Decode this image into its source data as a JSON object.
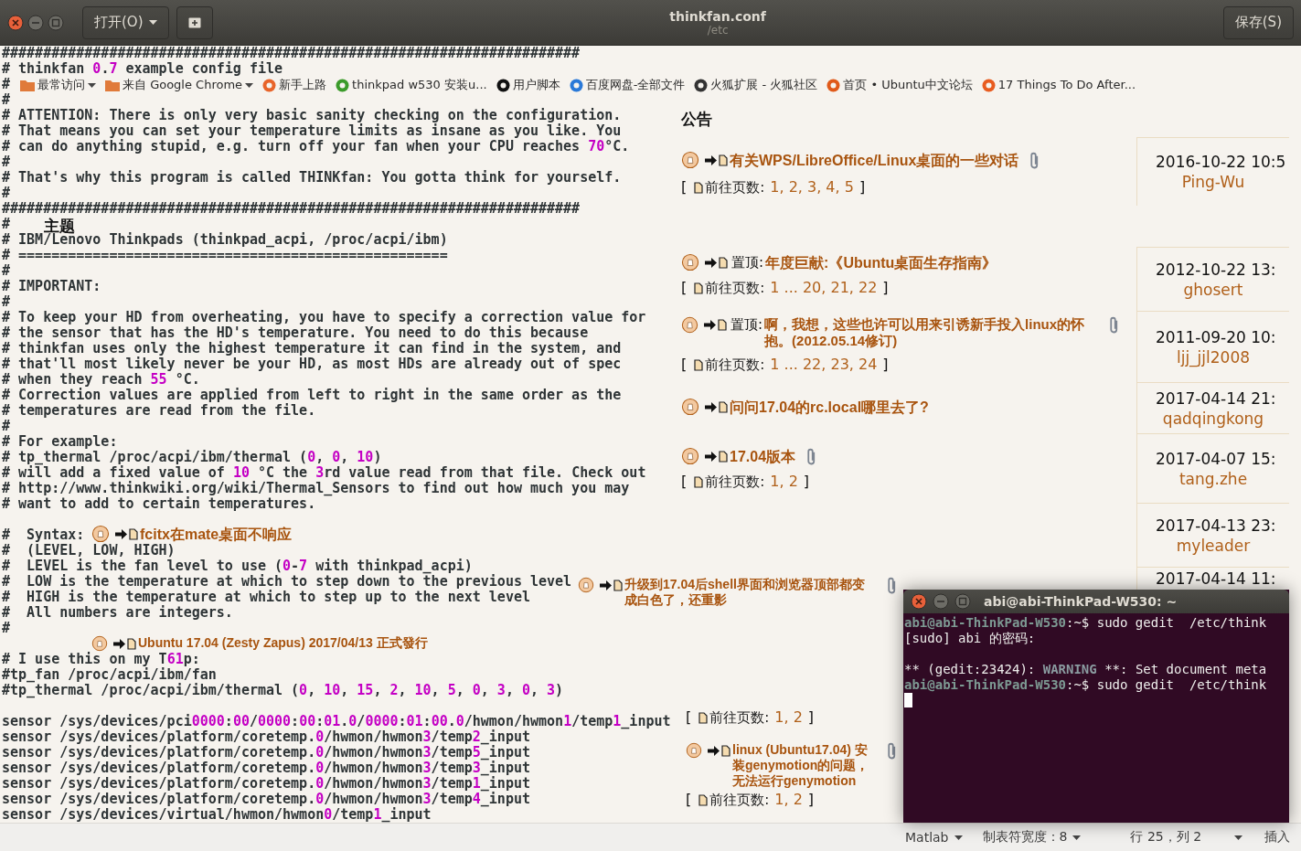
{
  "window": {
    "title": "thinkfan.conf",
    "subtitle": "/etc",
    "open_button": "打开(O)",
    "save_button": "保存(S)"
  },
  "editor": {
    "blocks": [
      [
        "######################################################################",
        "# thinkfan 0.7 example config file",
        "#",
        "#",
        "# ATTENTION: There is only very basic sanity checking on the configuration.",
        "# That means you can set your temperature limits as insane as you like. You",
        "# can do anything stupid, e.g. turn off your fan when your CPU reaches 70°C.",
        "#",
        "# That's why this program is called THINKfan: You gotta think for yourself.",
        "#",
        "######################################################################",
        "#",
        "# IBM/Lenovo Thinkpads (thinkpad_acpi, /proc/acpi/ibm)",
        "# ====================================================",
        "#",
        "# IMPORTANT:",
        "#",
        "# To keep your HD from overheating, you have to specify a correction value for",
        "# the sensor that has the HD's temperature. You need to do this because",
        "# thinkfan uses only the highest temperature it can find in the system, and",
        "# that'll most likely never be your HD, as most HDs are already out of spec",
        "# when they reach 55 °C.",
        "# Correction values are applied from left to right in the same order as the",
        "# temperatures are read from the file.",
        "#",
        "# For example:",
        "# tp_thermal /proc/acpi/ibm/thermal (0, 0, 10)",
        "# will add a fixed value of 10 °C the 3rd value read from that file. Check out",
        "# http://www.thinkwiki.org/wiki/Thermal_Sensors to find out how much you may",
        "# want to add to certain temperatures."
      ],
      [
        "#  Syntax:",
        "#  (LEVEL, LOW, HIGH)",
        "#  LEVEL is the fan level to use (0-7 with thinkpad_acpi)",
        "#  LOW is the temperature at which to step down to the previous level",
        "#  HIGH is the temperature at which to step up to the next level",
        "#  All numbers are integers.",
        "#"
      ],
      [
        "# I use this on my T61p:",
        "#tp_fan /proc/acpi/ibm/fan",
        "#tp_thermal /proc/acpi/ibm/thermal (0, 10, 15, 2, 10, 5, 0, 3, 0, 3)"
      ],
      [
        "sensor /sys/devices/pci0000:00/0000:00:01.0/0000:01:00.0/hwmon/hwmon1/temp1_input",
        "sensor /sys/devices/platform/coretemp.0/hwmon/hwmon3/temp2_input",
        "sensor /sys/devices/platform/coretemp.0/hwmon/hwmon3/temp5_input",
        "sensor /sys/devices/platform/coretemp.0/hwmon/hwmon3/temp3_input",
        "sensor /sys/devices/platform/coretemp.0/hwmon/hwmon3/temp1_input",
        "sensor /sys/devices/platform/coretemp.0/hwmon/hwmon3/temp4_input",
        "sensor /sys/devices/virtual/hwmon/hwmon0/temp1_input"
      ]
    ]
  },
  "bookmarks": [
    {
      "label": "最常访问",
      "menu": true
    },
    {
      "label": "来自 Google Chrome",
      "menu": true
    },
    {
      "label": "新手上路",
      "menu": false
    },
    {
      "label": "thinkpad w530 安装u...",
      "menu": false
    },
    {
      "label": "用户脚本",
      "menu": false
    },
    {
      "label": "百度网盘-全部文件",
      "menu": false
    },
    {
      "label": "火狐扩展 - 火狐社区",
      "menu": false
    },
    {
      "label": "首页 • Ubuntu中文论坛",
      "menu": false
    },
    {
      "label": "17 Things To Do After...",
      "menu": false
    }
  ],
  "forum": {
    "items": [
      {
        "kind": "heading",
        "text": "公告"
      },
      {
        "kind": "topic",
        "title": "有关WPS/LibreOffice/Linux桌面的一些对话",
        "attachment": true
      },
      {
        "kind": "pages",
        "open": "[",
        "label": "前往页数:",
        "numbers": "1, 2, 3, 4, 5",
        "close": "]"
      },
      {
        "kind": "heading",
        "text": "主题"
      },
      {
        "kind": "topic",
        "prefix": "置顶:",
        "title": "年度巨献:《Ubuntu桌面生存指南》",
        "attachment": false
      },
      {
        "kind": "pages",
        "open": "[",
        "label": "前往页数:",
        "numbers": "1 ... 20, 21, 22",
        "close": "]"
      },
      {
        "kind": "topic",
        "prefix": "置顶:",
        "title": "啊，我想，这些也许可以用来引诱新手投入linux的怀抱。(2012.05.14修订)",
        "attachment": true
      },
      {
        "kind": "pages",
        "open": "[",
        "label": "前往页数:",
        "numbers": "1 ... 22, 23, 24",
        "close": "]"
      },
      {
        "kind": "topic",
        "title": "问问17.04的rc.local哪里去了?",
        "attachment": false
      },
      {
        "kind": "topic",
        "title": "17.04版本",
        "attachment": true
      },
      {
        "kind": "pages",
        "open": "[",
        "label": "前往页数:",
        "numbers": "1, 2",
        "close": "]"
      },
      {
        "kind": "topic",
        "title": "fcitx在mate桌面不响应",
        "attachment": false
      },
      {
        "kind": "topic",
        "title": "升级到17.04后shell界面和浏览器顶部都变成白色了，还重影",
        "attachment": true
      },
      {
        "kind": "topic",
        "title": "Ubuntu 17.04 (Zesty Zapus) 2017/04/13 正式發行",
        "attachment": false
      },
      {
        "kind": "pages",
        "open": "[",
        "label": "前往页数:",
        "numbers": "1, 2",
        "close": "]"
      },
      {
        "kind": "topic",
        "title": "linux (Ubuntu17.04) 安装genymotion的问题，无法运行genymotion",
        "attachment": true
      },
      {
        "kind": "pages",
        "open": "[",
        "label": "前往页数:",
        "numbers": "1, 2",
        "close": "]"
      }
    ],
    "last_posts": [
      {
        "time": "2016-10-22 10:5",
        "author": "Ping-Wu"
      },
      {
        "time": "2012-10-22 13:",
        "author": "ghosert"
      },
      {
        "time": "2011-09-20 10:",
        "author": "ljj_jjl2008"
      },
      {
        "time": "2017-04-14 21:",
        "author": "qadqingkong"
      },
      {
        "time": "2017-04-07 15:",
        "author": "tang.zhe"
      },
      {
        "time": "2017-04-13 23:",
        "author": "myleader"
      },
      {
        "time": "2017-04-14 11:"
      }
    ]
  },
  "terminal": {
    "title": "abi@abi-ThinkPad-W530: ~",
    "lines": [
      {
        "kind": "command",
        "prompt": "abi@abi-ThinkPad-W530",
        "text": ":~$ sudo gedit  /etc/think"
      },
      {
        "kind": "output",
        "text": "[sudo] abi 的密码:"
      },
      {
        "kind": "blank"
      },
      {
        "kind": "warning",
        "before": "** (gedit:23424): ",
        "warning": "WARNING",
        "text": " **: Set document meta"
      },
      {
        "kind": "command",
        "prompt": "abi@abi-ThinkPad-W530",
        "text": ":~$ sudo gedit  /etc/think"
      },
      {
        "kind": "cursor"
      }
    ]
  },
  "status_bar": {
    "language": "Matlab",
    "tab_width": "制表符宽度：8",
    "position": "行 25，列 2",
    "mode": "插入"
  }
}
